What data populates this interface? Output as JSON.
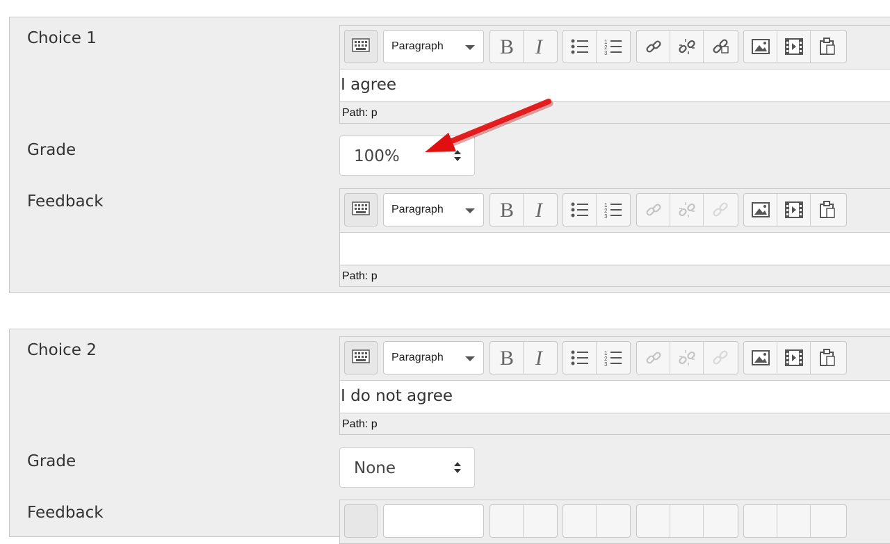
{
  "choice1": {
    "label": "Choice 1",
    "answer": "I agree",
    "path_label": "Path: p",
    "grade_label": "Grade",
    "grade_value": "100%",
    "feedback_label": "Feedback",
    "feedback_text": "",
    "feedback_path": "Path: p"
  },
  "choice2": {
    "label": "Choice 2",
    "answer": "I do not agree",
    "path_label": "Path: p",
    "grade_label": "Grade",
    "grade_value": "None",
    "feedback_label": "Feedback"
  },
  "toolbar": {
    "format_select": "Paragraph",
    "icons": [
      "keyboard-icon",
      "bold-icon",
      "italic-icon",
      "bullet-list-icon",
      "numbered-list-icon",
      "link-icon",
      "unlink-icon",
      "anchor-icon",
      "image-icon",
      "media-icon",
      "paste-icon"
    ]
  },
  "colors": {
    "fieldset_bg": "#eeeeee",
    "annotation_arrow": "#e01010"
  }
}
